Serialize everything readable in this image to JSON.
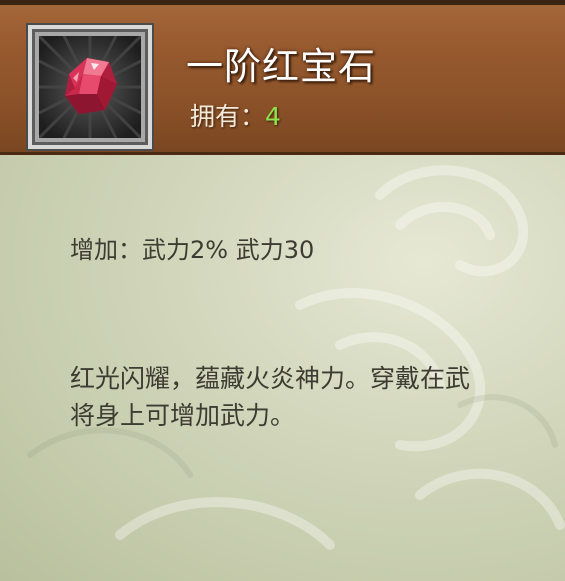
{
  "item": {
    "name": "一阶红宝石",
    "owned_label": "拥有：",
    "owned_count": "4",
    "icon": "red-ruby-gem-icon",
    "stat_text": "增加：武力2% 武力30",
    "description": "红光闪耀，蕴藏火炎神力。穿戴在武将身上可增加武力。"
  },
  "colors": {
    "header": "#96592e",
    "body": "#d0d4b8",
    "count": "#8ee24a",
    "gem": "#e0395e"
  }
}
